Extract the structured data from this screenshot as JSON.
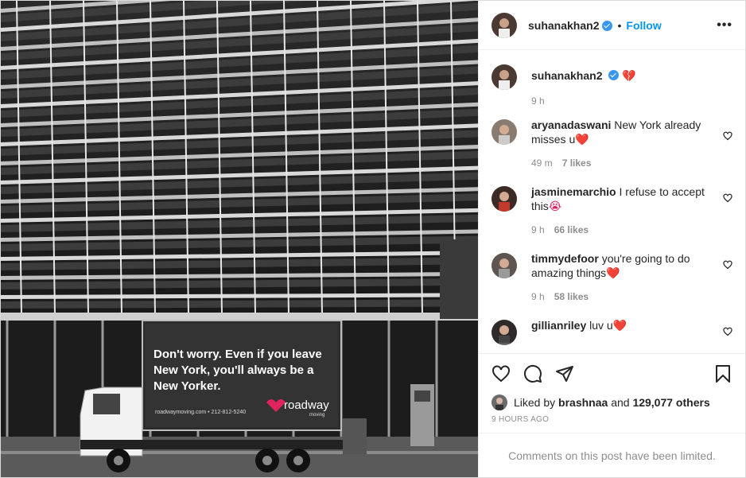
{
  "post": {
    "image_alt": "",
    "truck": {
      "headline_line1": "Don't worry. Even if you leave",
      "headline_line2": "New York, you'll always be a",
      "headline_line3": "New Yorker.",
      "brand": "roadway",
      "brand_sub": "moving",
      "url": "roadwaymoving.com • 212-812-5240"
    }
  },
  "header": {
    "username": "suhanakhan2",
    "separator": "•",
    "follow_label": "Follow",
    "more_icon": "more-horizontal-icon",
    "more_label": "•••"
  },
  "caption": {
    "username": "suhanakhan2",
    "text": "💔",
    "time": "9 h"
  },
  "comments": [
    {
      "username": "aryanadaswani",
      "text": "New York already misses u",
      "emoji": "❤️",
      "time": "49 m",
      "likes": "7 likes"
    },
    {
      "username": "jasminemarchio",
      "text": "I refuse to accept this",
      "emoji": "😭",
      "time": "9 h",
      "likes": "66 likes"
    },
    {
      "username": "timmydefoor",
      "text": "you're going to do amazing things",
      "emoji": "❤️",
      "time": "9 h",
      "likes": "58 likes"
    },
    {
      "username": "gillianriley",
      "text": "luv u",
      "emoji": "❤️",
      "time": "",
      "likes": ""
    }
  ],
  "actions": {
    "like_icon": "heart-icon",
    "comment_icon": "comment-icon",
    "share_icon": "share-icon",
    "save_icon": "bookmark-icon"
  },
  "likes": {
    "prefix": "Liked by",
    "user": "brashnaa",
    "connector": "and",
    "count": "129,077 others"
  },
  "timestamp": "9 HOURS AGO",
  "comments_notice": "Comments on this post have been limited.",
  "colors": {
    "link": "#0095f6",
    "verified": "#3897f0",
    "heart": "#e0245e",
    "muted": "#8e8e8e"
  }
}
